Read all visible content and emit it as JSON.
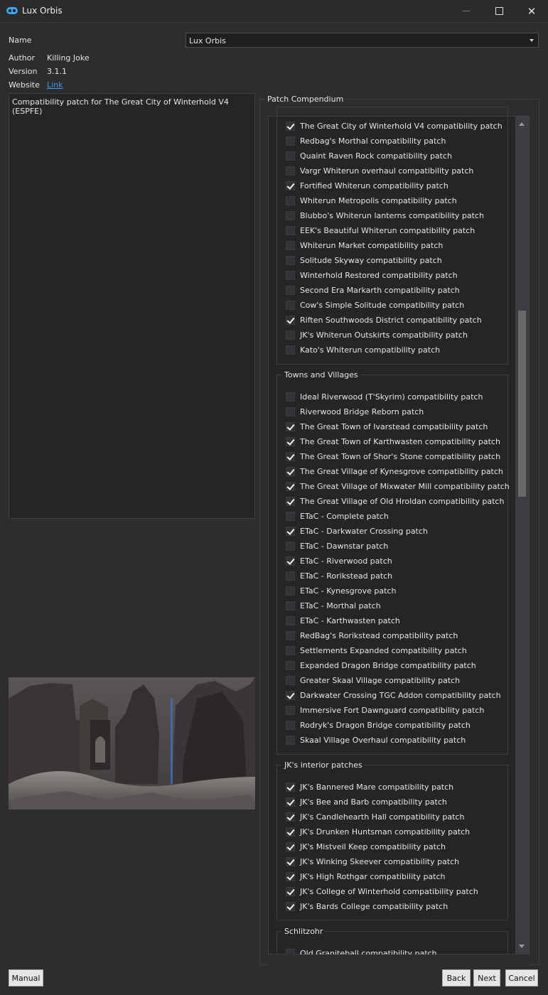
{
  "window": {
    "title": "Lux Orbis",
    "minimize_icon": "minimize-icon",
    "maximize_icon": "maximize-icon",
    "close_icon": "close-icon",
    "close_glyph": "✕"
  },
  "info": {
    "name_label": "Name",
    "name_value": "Lux Orbis",
    "author_label": "Author",
    "author_value": "Killing Joke",
    "version_label": "Version",
    "version_value": "3.1.1",
    "website_label": "Website",
    "website_link": "Link"
  },
  "description": "Compatibility patch for The Great City of Winterhold V4 (ESPFE)",
  "compendium": {
    "title": "Patch Compendium",
    "groups": [
      {
        "title": "",
        "items": [
          {
            "label": "The Great City of Winterhold V4 compatibility patch",
            "checked": true
          },
          {
            "label": "Redbag's Morthal compatibility patch",
            "checked": false
          },
          {
            "label": "Quaint Raven Rock compatibility patch",
            "checked": false
          },
          {
            "label": "Vargr Whiterun overhaul compatibility patch",
            "checked": false
          },
          {
            "label": "Fortified Whiterun compatibility patch",
            "checked": true
          },
          {
            "label": "Whiterun Metropolis compatibility patch",
            "checked": false
          },
          {
            "label": "Blubbo's Whiterun lanterns compatibility patch",
            "checked": false
          },
          {
            "label": "EEK's Beautiful Whiterun compatibility patch",
            "checked": false
          },
          {
            "label": "Whiterun Market compatibility patch",
            "checked": false
          },
          {
            "label": "Solitude Skyway compatibility patch",
            "checked": false
          },
          {
            "label": "Winterhold Restored compatibility patch",
            "checked": false
          },
          {
            "label": "Second Era Markarth compatibility patch",
            "checked": false
          },
          {
            "label": "Cow's Simple Solitude compatibility patch",
            "checked": false
          },
          {
            "label": "Riften Southwoods District compatibility patch",
            "checked": true
          },
          {
            "label": "JK's Whiterun Outskirts compatibility patch",
            "checked": false
          },
          {
            "label": "Kato's Whiterun compatibility patch",
            "checked": false
          }
        ]
      },
      {
        "title": "Towns and Villages",
        "items": [
          {
            "label": "Ideal Riverwood (T'Skyrim) compatibility patch",
            "checked": false
          },
          {
            "label": "Riverwood Bridge Reborn patch",
            "checked": false
          },
          {
            "label": "The Great Town of Ivarstead compatibility patch",
            "checked": true
          },
          {
            "label": "The Great Town of Karthwasten compatibility patch",
            "checked": true
          },
          {
            "label": "The Great Town of Shor's Stone compatibility patch",
            "checked": true
          },
          {
            "label": "The Great Village of Kynesgrove compatibility patch",
            "checked": true
          },
          {
            "label": "The Great Village of Mixwater Mill compatibility patch",
            "checked": true
          },
          {
            "label": "The Great Village of Old Hroldan compatibility patch",
            "checked": true
          },
          {
            "label": "ETaC - Complete patch",
            "checked": false
          },
          {
            "label": "ETaC - Darkwater Crossing patch",
            "checked": true
          },
          {
            "label": "ETaC - Dawnstar patch",
            "checked": false
          },
          {
            "label": "ETaC - Riverwood patch",
            "checked": true
          },
          {
            "label": "ETaC - Rorikstead patch",
            "checked": false
          },
          {
            "label": "ETaC - Kynesgrove patch",
            "checked": false
          },
          {
            "label": "ETaC - Morthal patch",
            "checked": false
          },
          {
            "label": "ETaC - Karthwasten patch",
            "checked": false
          },
          {
            "label": "RedBag's Rorikstead compatibility patch",
            "checked": false
          },
          {
            "label": "Settlements Expanded compatibility patch",
            "checked": false
          },
          {
            "label": "Expanded Dragon Bridge compatibility patch",
            "checked": false
          },
          {
            "label": "Greater Skaal Village compatibility patch",
            "checked": false
          },
          {
            "label": "Darkwater Crossing TGC Addon compatibility patch",
            "checked": true
          },
          {
            "label": "Immersive Fort Dawnguard compatibility patch",
            "checked": false
          },
          {
            "label": "Rodryk's Dragon Bridge compatibility patch",
            "checked": false
          },
          {
            "label": "Skaal Village Overhaul compatibility patch",
            "checked": false
          }
        ]
      },
      {
        "title": "JK's interior patches",
        "items": [
          {
            "label": "JK's Bannered Mare compatibility patch",
            "checked": true
          },
          {
            "label": "JK's Bee and Barb compatibility patch",
            "checked": true
          },
          {
            "label": "JK's Candlehearth Hall compatibility patch",
            "checked": true
          },
          {
            "label": "JK's Drunken Huntsman compatibility patch",
            "checked": true
          },
          {
            "label": "JK's Mistveil Keep compatibility patch",
            "checked": true
          },
          {
            "label": "JK's Winking Skeever compatibility patch",
            "checked": true
          },
          {
            "label": "JK's High Rothgar compatibility patch",
            "checked": true
          },
          {
            "label": "JK's College of Winterhold compatibility patch",
            "checked": true
          },
          {
            "label": "JK's Bards College compatibility patch",
            "checked": true
          }
        ]
      },
      {
        "title": "Schlitzohr",
        "items": [
          {
            "label": "Old Graniteball compatibility patch",
            "checked": false
          }
        ]
      }
    ]
  },
  "buttons": {
    "manual": "Manual",
    "back": "Back",
    "next": "Next",
    "cancel": "Cancel"
  }
}
